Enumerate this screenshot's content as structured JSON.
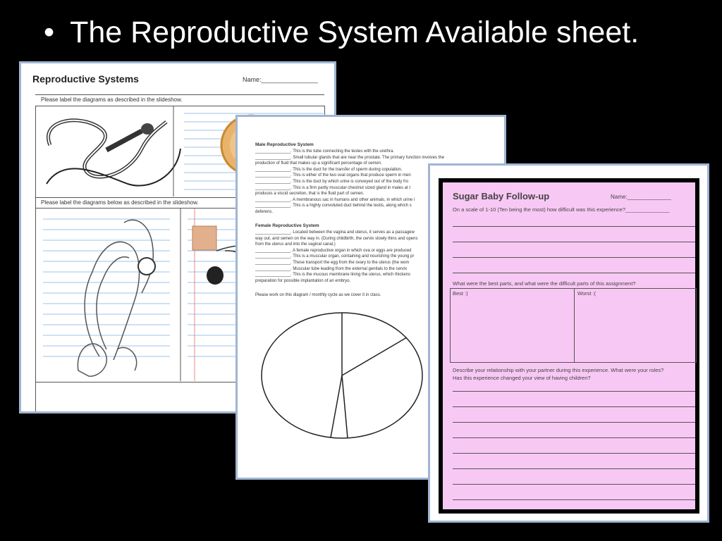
{
  "slide": {
    "bullet": "•",
    "title": "The Reproductive System Available sheet."
  },
  "sheet1": {
    "title": "Reproductive Systems",
    "name_label": "Name:________________",
    "instruction_top": "Please label the diagrams as described in the slideshow.",
    "instruction_bottom": "Please label the diagrams below as described in the slideshow."
  },
  "sheet2": {
    "male_heading": "Male Reproductive System",
    "male_lines": [
      "_______________. This is the tube connecting the testes with the urethra.",
      "_______________. Small tubular glands that are near the prostate. The primary function involves the",
      "production of fluid that makes up a significant percentage of semen.",
      "_______________. This is the duct for the transfer of sperm during copulation.",
      "_______________. This is either of the two oval organs that produce sperm in men",
      "_______________. This is the duct by which urine is conveyed out of the body fro",
      "_______________. This is a firm partly muscular chestnut sized gland in males at t",
      "produces a viscid secretion, that is the fluid part of semen.",
      "_______________. A membranous sac in humans and other animals, in which urine i",
      "_______________. This is a highly convoluted duct behind the testis, along which s",
      "deferens."
    ],
    "female_heading": "Female Reproductive System",
    "female_lines": [
      "_______________. Located between the vagina and uterus, it serves as a passagew",
      "way out, and semen on the way in. (During childbirth, the cervix slowly thins and opens",
      "from the uterus and into the vaginal canal.)",
      "_______________. A female reproductive organ in which ova or eggs are produced",
      "_______________. This is a muscular organ, containing and nourishing the young pr",
      "_______________. These transport the egg from the ovary to the uterus (the wom",
      "_______________. Muscular tube leading from the external genitals to the cervix",
      "_______________. This is the mucous membrane lining the uterus, which thickens",
      "preparation for possible implantation of an embryo."
    ],
    "diagram_instruction": "Please work on this diagram / monthly cycle as we cover it in class."
  },
  "sheet3": {
    "title": "Sugar Baby Follow-up",
    "name_label": "Name:______________",
    "q1": "On a scale of 1-10 (Ten being the most) how difficult was this experience?_______________",
    "q2": "What were the best parts, and what were the difficult parts of this assignment?",
    "best_label": "Best :)",
    "worst_label": "Worst :(",
    "q3a": "Describe your relationship with your partner during this experience.  What were your roles?",
    "q3b": "Has this experience changed your view of having children?"
  },
  "colors": {
    "background": "#000000",
    "sheet_border": "#9fb6d3",
    "pink": "#f8c8f4"
  }
}
